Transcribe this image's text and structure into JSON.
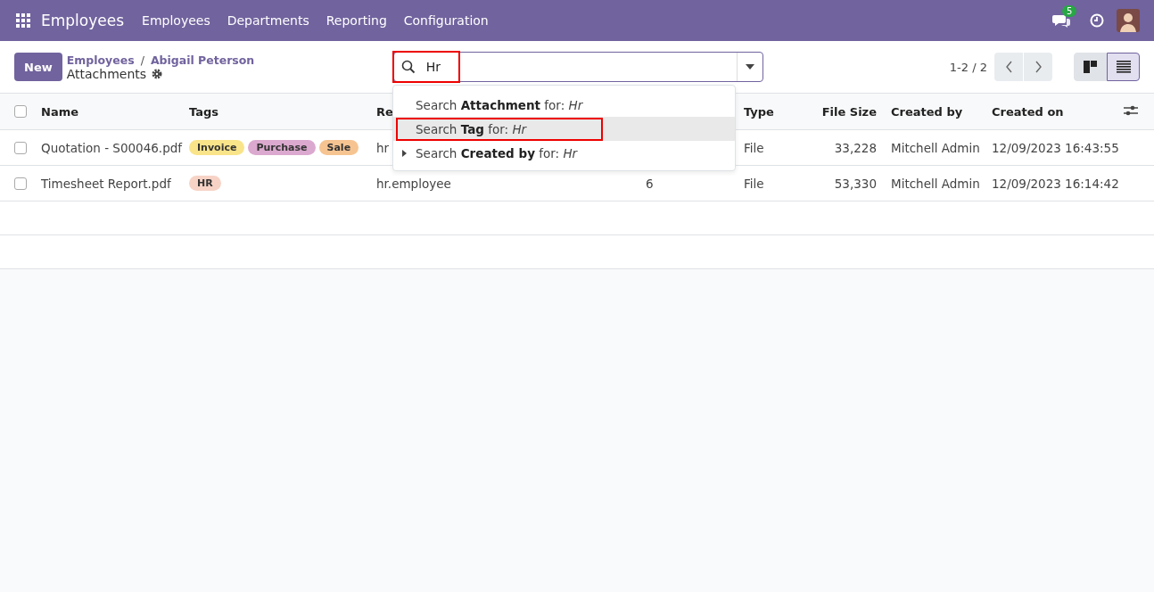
{
  "navbar": {
    "app_name": "Employees",
    "menu": [
      "Employees",
      "Departments",
      "Reporting",
      "Configuration"
    ],
    "message_count": "5"
  },
  "control_panel": {
    "new_button": "New",
    "breadcrumbs": [
      "Employees",
      "Abigail Peterson"
    ],
    "breadcrumb_separator": "/",
    "current": "Attachments",
    "pager": "1-2 / 2",
    "views": [
      {
        "kind": "kanban",
        "selected": false
      },
      {
        "kind": "list",
        "selected": true
      }
    ]
  },
  "search": {
    "value": "Hr",
    "annotated": true,
    "suggestions": [
      {
        "text": "Search **Attachment** for: *Hr*",
        "selected": false,
        "expandable": false,
        "annotated": false
      },
      {
        "text": "Search **Tag** for: *Hr*",
        "selected": true,
        "expandable": false,
        "annotated": true
      },
      {
        "text": "Search **Created by** for: *Hr*",
        "selected": false,
        "expandable": true,
        "annotated": false
      }
    ]
  },
  "table": {
    "all_selected": false,
    "columns": [
      "Name",
      "Tags",
      "Re",
      "Type",
      "File Size",
      "Created by",
      "Created on"
    ],
    "rows": [
      {
        "checked": false,
        "name": "Quotation - S00046.pdf",
        "tags": [
          {
            "label": "Invoice",
            "color": "#f9e48a"
          },
          {
            "label": "Purchase",
            "color": "#dba9cf"
          },
          {
            "label": "Sale",
            "color": "#f6c491"
          }
        ],
        "column_4": "hr",
        "type": "File",
        "file_size": "33,228",
        "created_by": "Mitchell Admin",
        "created_on": "12/09/2023 16:43:55"
      },
      {
        "checked": false,
        "name": "Timesheet Report.pdf",
        "tags": [
          {
            "label": "HR",
            "color": "#f7d3c6"
          }
        ],
        "column_4": "hr.employee",
        "column_5": "6",
        "type": "File",
        "file_size": "53,330",
        "created_by": "Mitchell Admin",
        "created_on": "12/09/2023 16:14:42"
      }
    ]
  }
}
